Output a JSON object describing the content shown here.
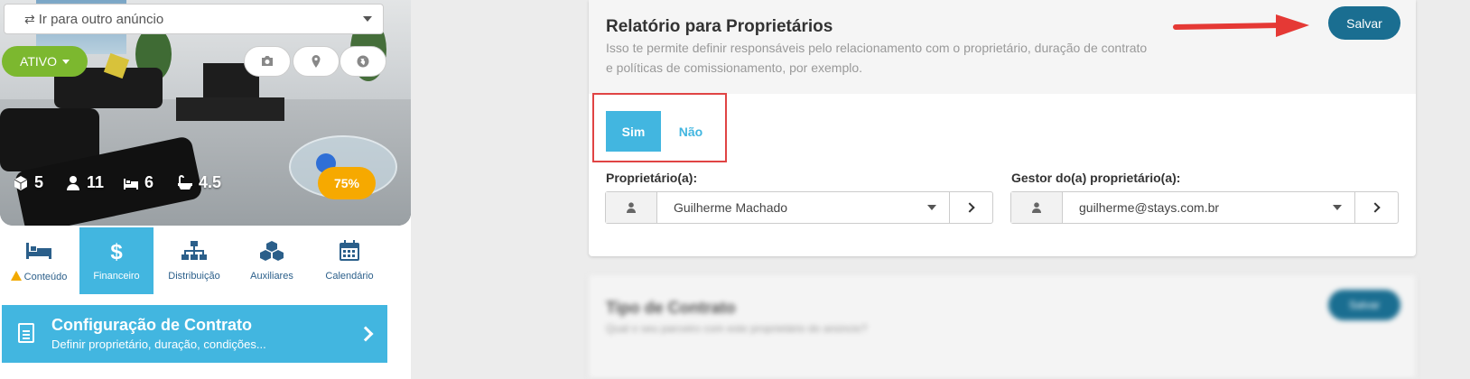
{
  "listing": {
    "ad_select_label": "Ir para outro anúncio",
    "status_label": "ATIVO",
    "stats": {
      "rooms": "5",
      "guests": "11",
      "beds": "6",
      "baths": "4.5"
    },
    "completion": "75%"
  },
  "nav": {
    "tabs": [
      {
        "label": "Conteúdo",
        "icon": "bed-icon",
        "active": false,
        "warning": true
      },
      {
        "label": "Financeiro",
        "icon": "dollar-icon",
        "active": true,
        "warning": false
      },
      {
        "label": "Distribuição",
        "icon": "sitemap-icon",
        "active": false,
        "warning": false
      },
      {
        "label": "Auxiliares",
        "icon": "cubes-icon",
        "active": false,
        "warning": false
      },
      {
        "label": "Calendário",
        "icon": "calendar-icon",
        "active": false,
        "warning": false
      }
    ]
  },
  "contract_banner": {
    "title": "Configuração de Contrato",
    "subtitle": "Definir proprietário, duração, condições..."
  },
  "owner_report": {
    "title": "Relatório para Proprietários",
    "description": "Isso te permite definir responsáveis pelo relacionamento com o proprietário, duração de contrato e políticas de comissionamento, por exemplo.",
    "save_label": "Salvar",
    "yes_label": "Sim",
    "no_label": "Não",
    "selected": "Sim",
    "owner_label": "Proprietário(a):",
    "owner_value": "Guilherme Machado",
    "manager_label": "Gestor do(a) proprietário(a):",
    "manager_value": "guilherme@stays.com.br"
  },
  "contract_type": {
    "title": "Tipo de Contrato",
    "description": "Qual o seu parceiro com este proprietário do anúncio?",
    "button_label": "Salvar"
  },
  "colors": {
    "accent": "#42b6e0",
    "save": "#1a6e91",
    "active_status": "#7cb82f",
    "completion": "#f6a900",
    "highlight": "#e04444"
  }
}
